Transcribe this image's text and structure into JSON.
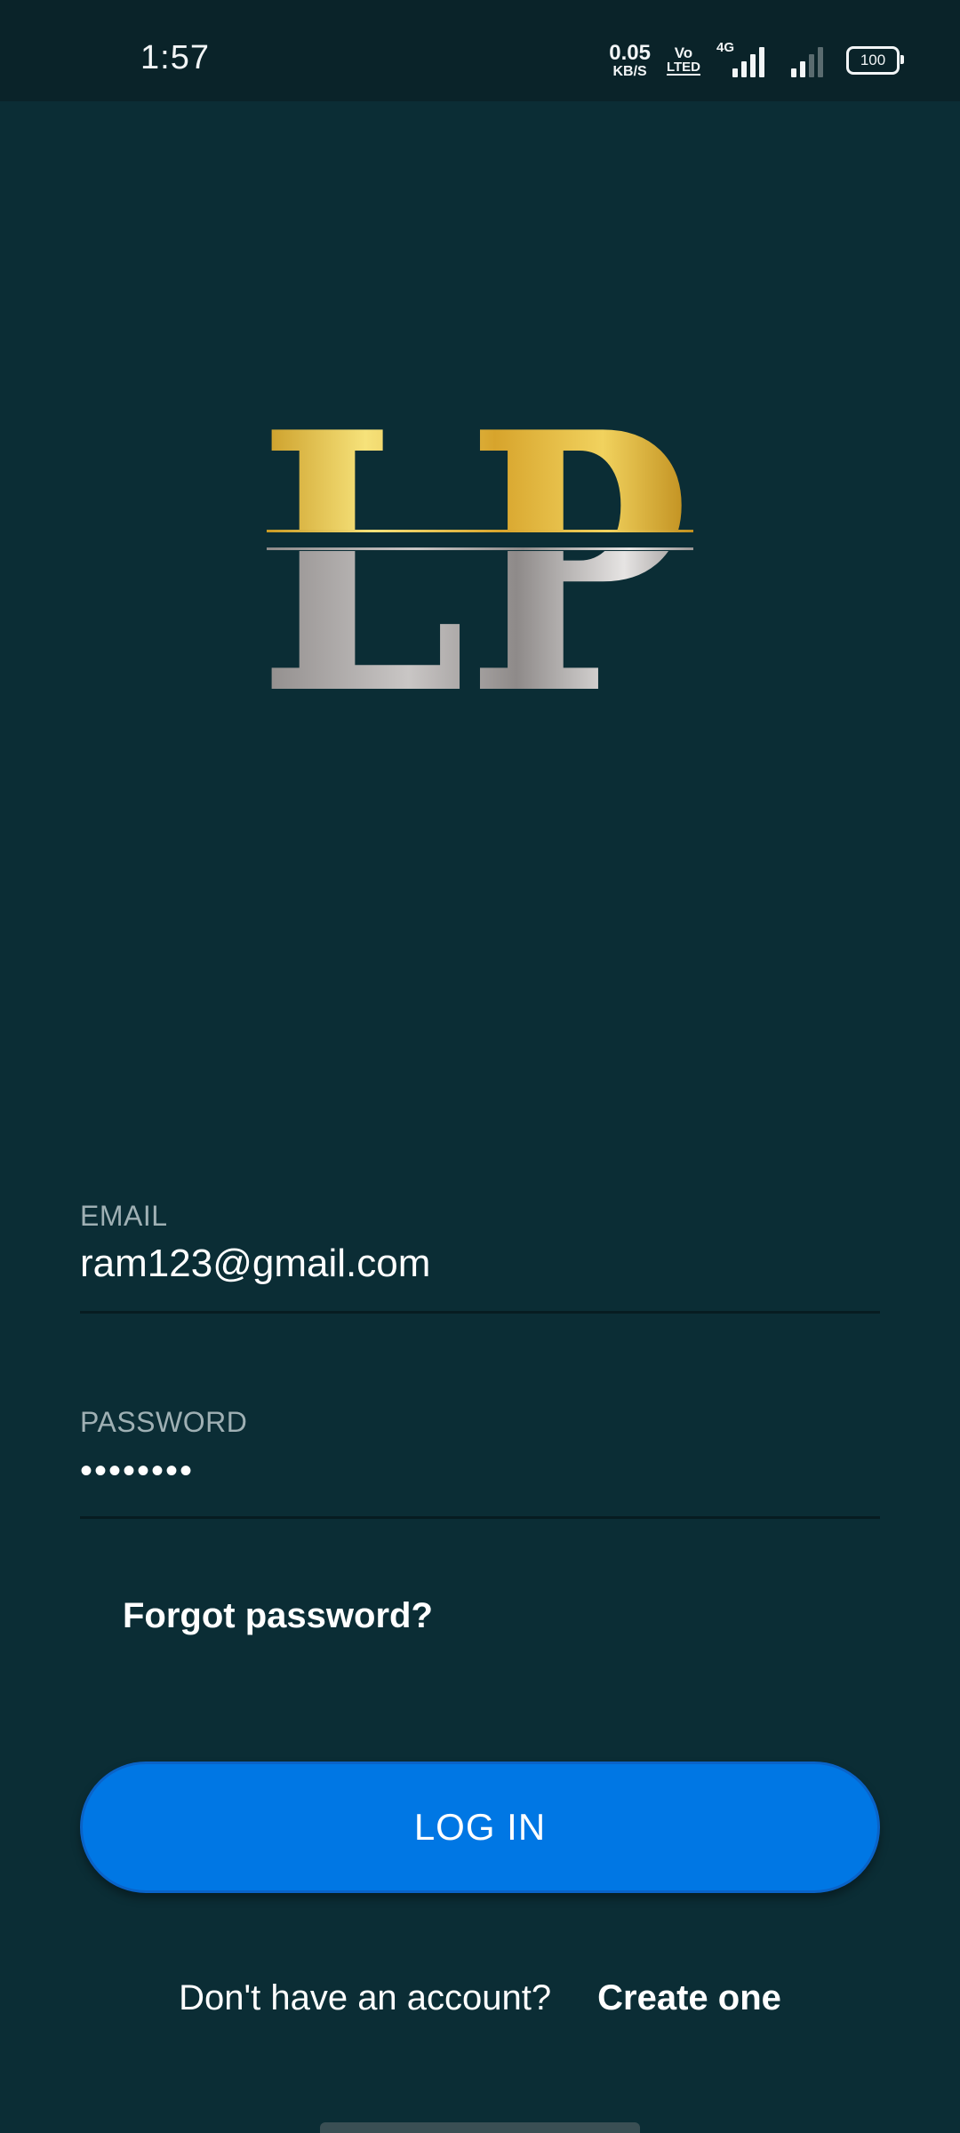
{
  "status_bar": {
    "time": "1:57",
    "net_speed_value": "0.05",
    "net_speed_unit": "KB/S",
    "volte_top": "Vo",
    "volte_bottom": "LTED",
    "network_type": "4G",
    "battery": "100"
  },
  "logo": {
    "text": "LP",
    "gold_color": "#e2b234",
    "silver_color": "#a9a6a5"
  },
  "form": {
    "email": {
      "label": "EMAIL",
      "value": "ram123@gmail.com"
    },
    "password": {
      "label": "PASSWORD",
      "value": "••••••••"
    },
    "forgot_password": "Forgot password?",
    "login_button": "LOG IN",
    "signup_prompt": "Don't have an account?",
    "create_account": "Create one"
  },
  "colors": {
    "background": "#0b2d35",
    "status_bar": "#0a2329",
    "primary_button": "#0077e4"
  }
}
